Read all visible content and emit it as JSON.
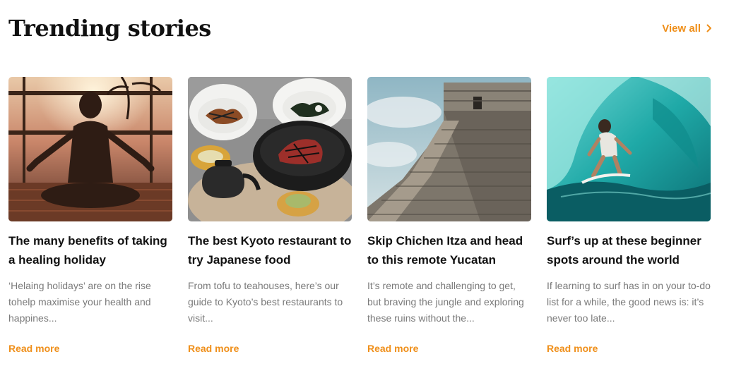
{
  "header": {
    "title": "Trending stories",
    "view_all_label": "View all",
    "accent_color": "#ef8f1a"
  },
  "cards": [
    {
      "title": "The many benefits of taking a healing holiday",
      "description": "‘Helaing holidays’ are on the rise tohelp maximise your health and happines...",
      "link_label": "Read more",
      "image": "meditation-sunset-photo"
    },
    {
      "title": "The best Kyoto restaurant to try Japanese food",
      "description": "From tofu to teahouses, here’s our guide to Kyoto’s best restaurants to visit...",
      "link_label": "Read more",
      "image": "japanese-food-bowls-photo"
    },
    {
      "title": "Skip Chichen Itza and head to this remote Yucatan",
      "description": "It’s remote and challenging to get, but braving the jungle and exploring these ruins without the...",
      "link_label": "Read more",
      "image": "mayan-pyramid-photo"
    },
    {
      "title": "Surf’s up at these beginner spots around the world",
      "description": "If learning to surf has in on your to-do list for a while, the good news is: it’s never too late...",
      "link_label": "Read more",
      "image": "surfer-wave-photo"
    }
  ]
}
